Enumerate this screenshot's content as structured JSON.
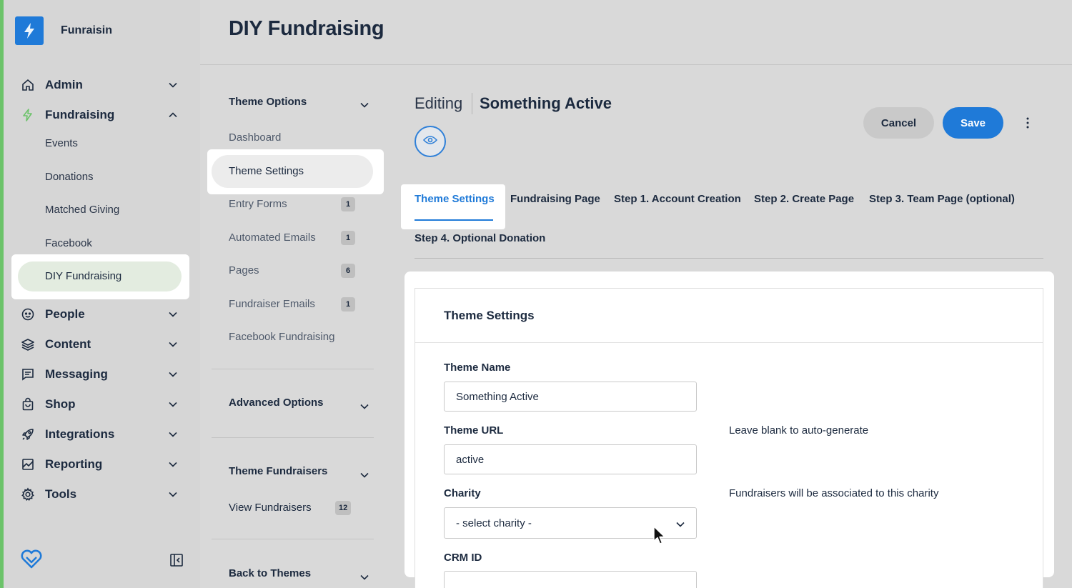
{
  "app": {
    "name": "Funraisin",
    "accent_color": "#1f7ad8",
    "brand_green": "#6cc36a"
  },
  "sidebar": {
    "items": [
      {
        "label": "Admin",
        "icon": "home-icon",
        "expanded": false
      },
      {
        "label": "Fundraising",
        "icon": "lightning-icon",
        "expanded": true,
        "children": [
          "Events",
          "Donations",
          "Matched Giving",
          "Facebook",
          "DIY Fundraising"
        ],
        "active_child": "DIY Fundraising"
      },
      {
        "label": "People",
        "icon": "face-icon",
        "expanded": false
      },
      {
        "label": "Content",
        "icon": "layers-icon",
        "expanded": false
      },
      {
        "label": "Messaging",
        "icon": "message-icon",
        "expanded": false
      },
      {
        "label": "Shop",
        "icon": "bag-icon",
        "expanded": false
      },
      {
        "label": "Integrations",
        "icon": "rocket-icon",
        "expanded": false
      },
      {
        "label": "Reporting",
        "icon": "chart-icon",
        "expanded": false
      },
      {
        "label": "Tools",
        "icon": "gear-icon",
        "expanded": false
      }
    ],
    "footer_icons": [
      "heart-logo-icon",
      "collapse-sidebar-icon"
    ]
  },
  "header": {
    "title": "DIY Fundraising"
  },
  "secondary_nav": {
    "theme_options": {
      "heading": "Theme Options",
      "items": [
        {
          "label": "Dashboard",
          "count": null
        },
        {
          "label": "Theme Settings",
          "count": null
        },
        {
          "label": "Entry Forms",
          "count": "1"
        },
        {
          "label": "Automated Emails",
          "count": "1"
        },
        {
          "label": "Pages",
          "count": "6"
        },
        {
          "label": "Fundraiser Emails",
          "count": "1"
        },
        {
          "label": "Facebook Fundraising",
          "count": null
        }
      ],
      "active": "Theme Settings"
    },
    "advanced_options": {
      "heading": "Advanced Options"
    },
    "theme_fundraisers": {
      "heading": "Theme Fundraisers",
      "items": [
        {
          "label": "View Fundraisers",
          "count": "12"
        }
      ]
    },
    "back_to_themes": {
      "heading": "Back to Themes"
    }
  },
  "editor": {
    "editing_label": "Editing",
    "theme_name": "Something Active",
    "preview_icon": "eye-icon",
    "cancel_label": "Cancel",
    "save_label": "Save",
    "more_icon": "more-vertical-icon"
  },
  "tabs": [
    {
      "label": "Theme Settings",
      "active": true
    },
    {
      "label": "Fundraising Page",
      "active": false
    },
    {
      "label": "Step 1. Account Creation",
      "active": false
    },
    {
      "label": "Step 2. Create Page",
      "active": false
    },
    {
      "label": "Step 3. Team Page (optional)",
      "active": false
    },
    {
      "label": "Step 4. Optional Donation",
      "active": false
    }
  ],
  "form": {
    "title": "Theme Settings",
    "theme_name": {
      "label": "Theme Name",
      "value": "Something Active"
    },
    "theme_url": {
      "label": "Theme URL",
      "value": "active",
      "help": "Leave blank to auto-generate"
    },
    "charity": {
      "label": "Charity",
      "value": "- select charity -",
      "help": "Fundraisers will be associated to this charity"
    },
    "crm_id": {
      "label": "CRM ID",
      "value": ""
    }
  }
}
